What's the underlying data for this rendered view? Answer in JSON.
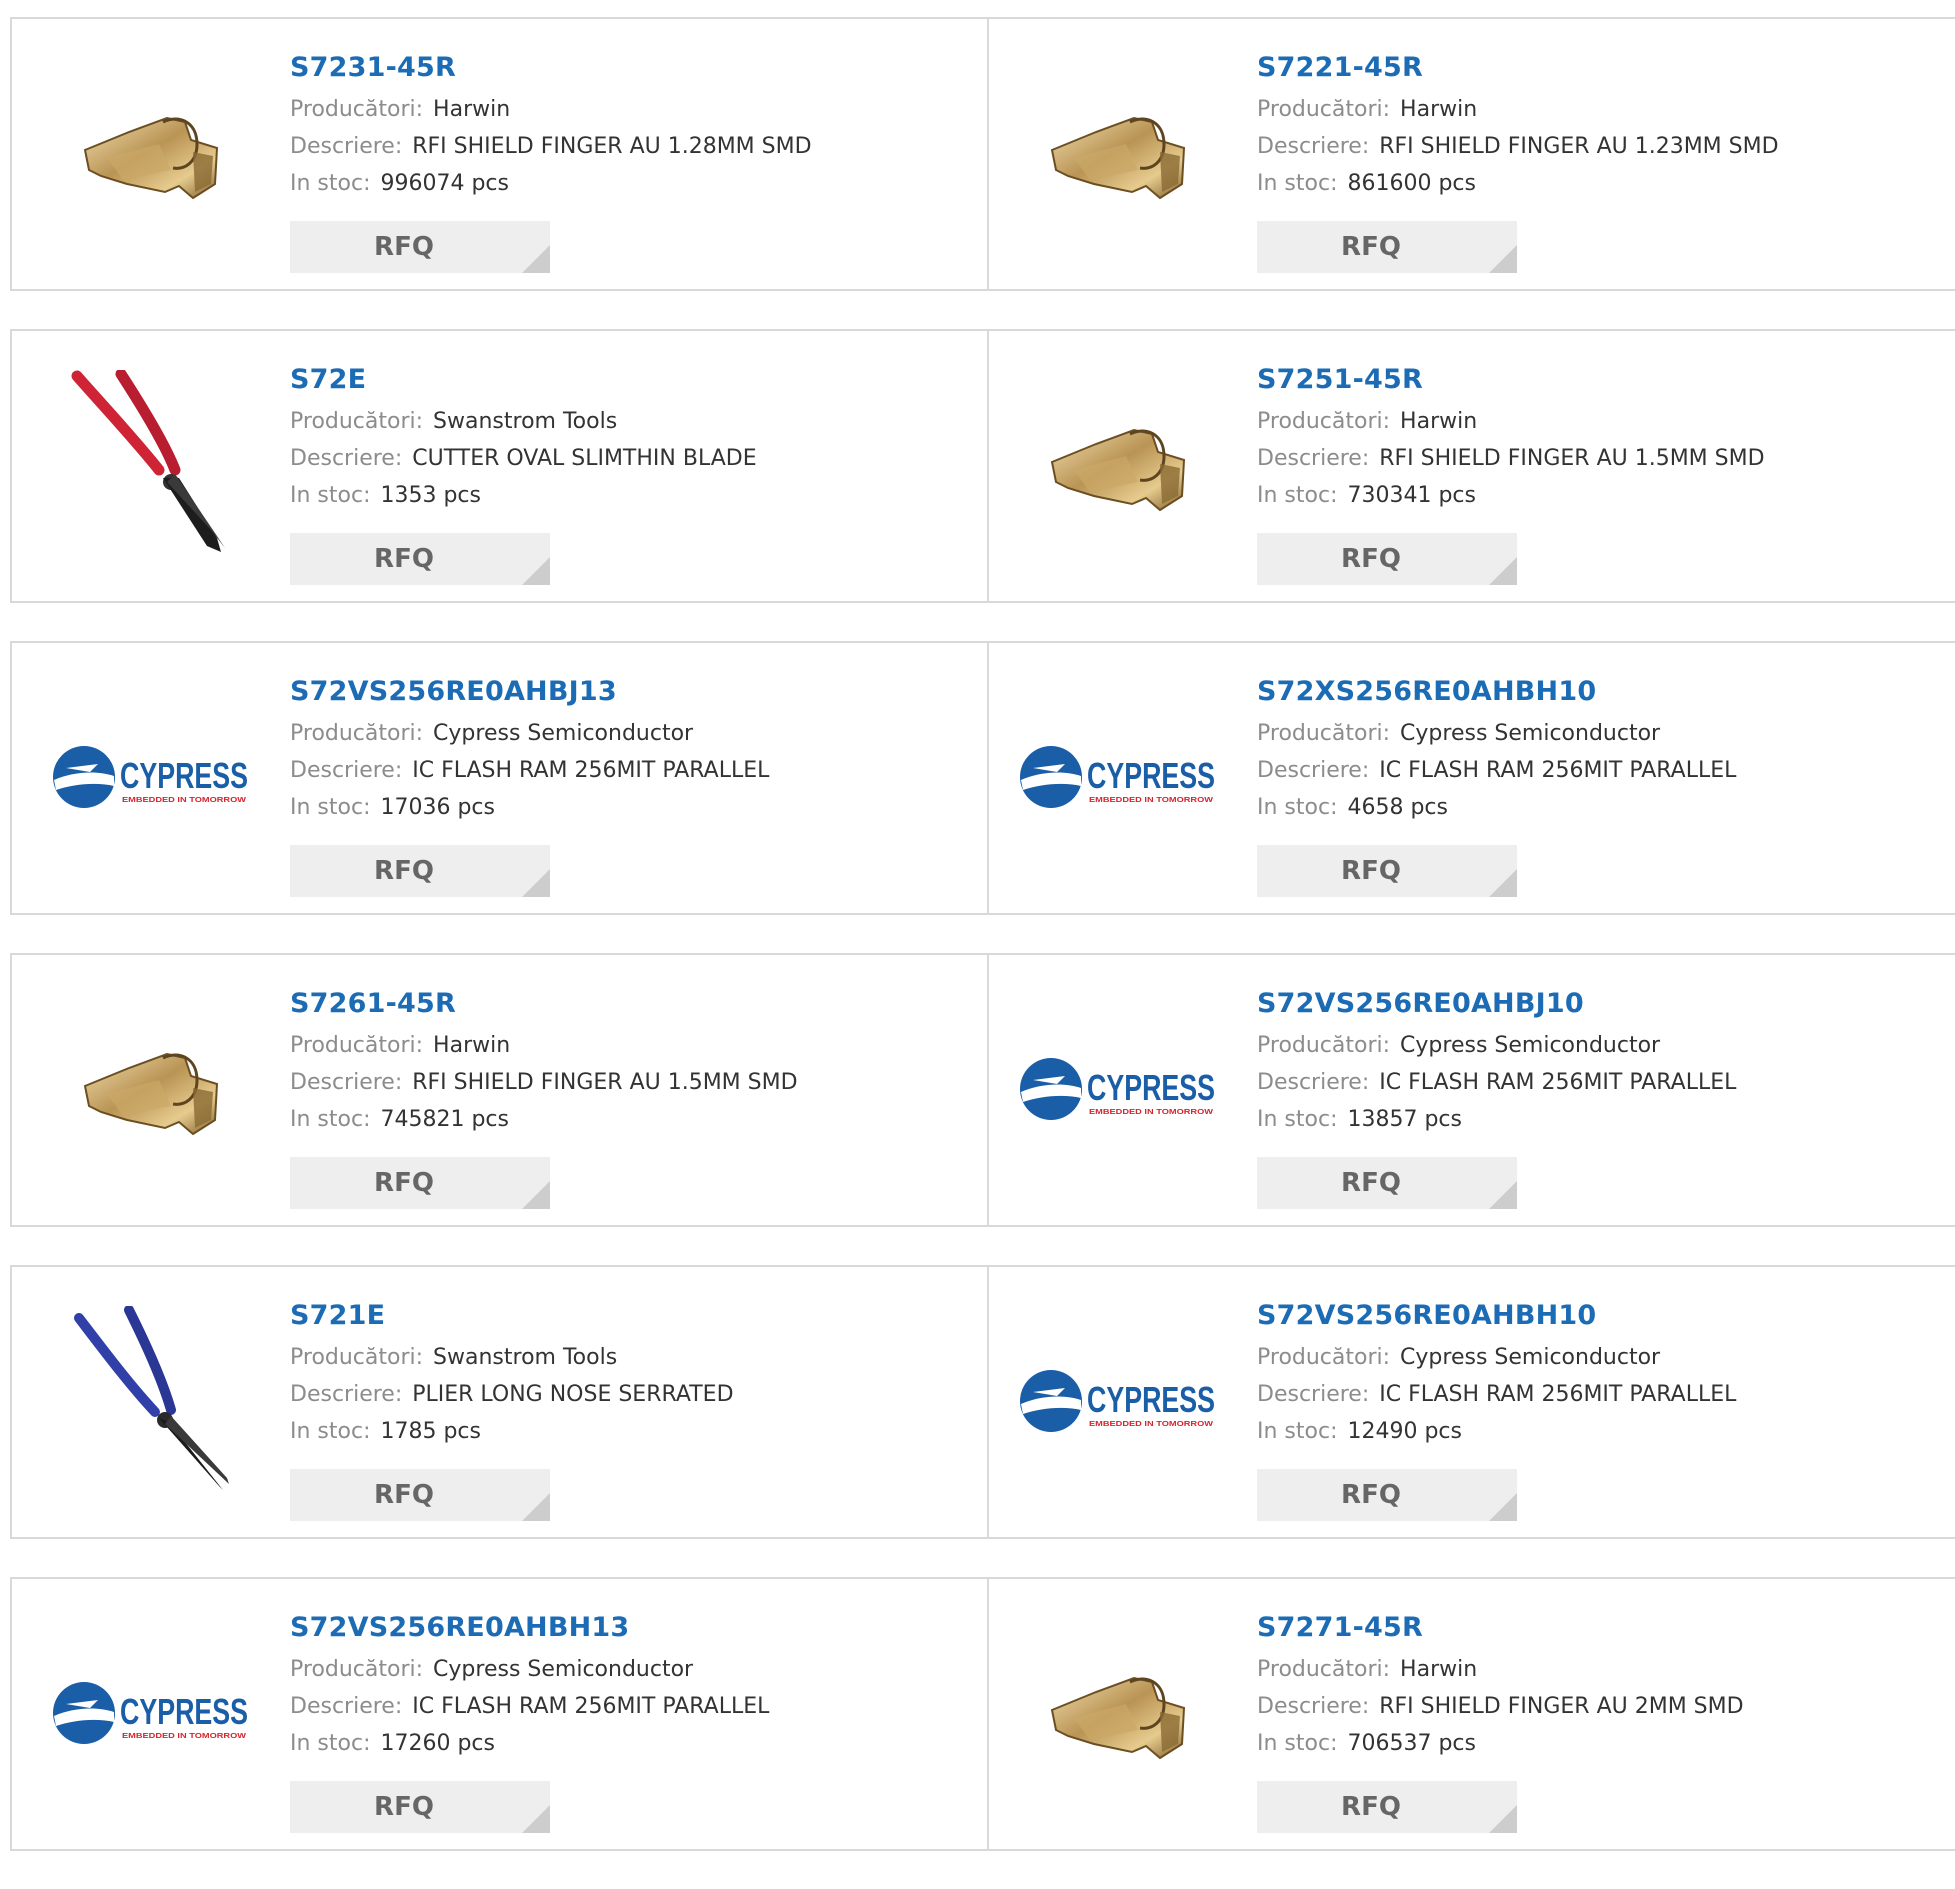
{
  "labels": {
    "manufacturer": "Producători:",
    "description": "Descriere:",
    "stock": "In stoc:",
    "rfq": "RFQ"
  },
  "colors": {
    "part_link": "#1c6bb5",
    "label": "#8c8c8c",
    "value": "#333333",
    "rfq_bg": "#eeeeee",
    "border": "#d9d9d9"
  },
  "products": [
    {
      "part": "S7231-45R",
      "manufacturer": "Harwin",
      "description": "RFI SHIELD FINGER AU 1.28MM SMD",
      "stock": "996074 pcs",
      "image": "shield-finger-image"
    },
    {
      "part": "S7221-45R",
      "manufacturer": "Harwin",
      "description": "RFI SHIELD FINGER AU 1.23MM SMD",
      "stock": "861600 pcs",
      "image": "shield-finger-image"
    },
    {
      "part": "S72E",
      "manufacturer": "Swanstrom Tools",
      "description": "CUTTER OVAL SLIMTHIN BLADE",
      "stock": "1353 pcs",
      "image": "red-cutter-image"
    },
    {
      "part": "S7251-45R",
      "manufacturer": "Harwin",
      "description": "RFI SHIELD FINGER AU 1.5MM SMD",
      "stock": "730341 pcs",
      "image": "shield-finger-image"
    },
    {
      "part": "S72VS256RE0AHBJ13",
      "manufacturer": "Cypress Semiconductor",
      "description": "IC FLASH RAM 256MIT PARALLEL",
      "stock": "17036 pcs",
      "image": "cypress-logo"
    },
    {
      "part": "S72XS256RE0AHBH10",
      "manufacturer": "Cypress Semiconductor",
      "description": "IC FLASH RAM 256MIT PARALLEL",
      "stock": "4658 pcs",
      "image": "cypress-logo"
    },
    {
      "part": "S7261-45R",
      "manufacturer": "Harwin",
      "description": "RFI SHIELD FINGER AU 1.5MM SMD",
      "stock": "745821 pcs",
      "image": "shield-finger-image"
    },
    {
      "part": "S72VS256RE0AHBJ10",
      "manufacturer": "Cypress Semiconductor",
      "description": "IC FLASH RAM 256MIT PARALLEL",
      "stock": "13857 pcs",
      "image": "cypress-logo"
    },
    {
      "part": "S721E",
      "manufacturer": "Swanstrom Tools",
      "description": "PLIER LONG NOSE SERRATED",
      "stock": "1785 pcs",
      "image": "blue-plier-image"
    },
    {
      "part": "S72VS256RE0AHBH10",
      "manufacturer": "Cypress Semiconductor",
      "description": "IC FLASH RAM 256MIT PARALLEL",
      "stock": "12490 pcs",
      "image": "cypress-logo"
    },
    {
      "part": "S72VS256RE0AHBH13",
      "manufacturer": "Cypress Semiconductor",
      "description": "IC FLASH RAM 256MIT PARALLEL",
      "stock": "17260 pcs",
      "image": "cypress-logo"
    },
    {
      "part": "S7271-45R",
      "manufacturer": "Harwin",
      "description": "RFI SHIELD FINGER AU 2MM SMD",
      "stock": "706537 pcs",
      "image": "shield-finger-image"
    }
  ],
  "logo": {
    "cypress_word": "CYPRESS",
    "cypress_tagline": "EMBEDDED IN TOMORROW"
  }
}
